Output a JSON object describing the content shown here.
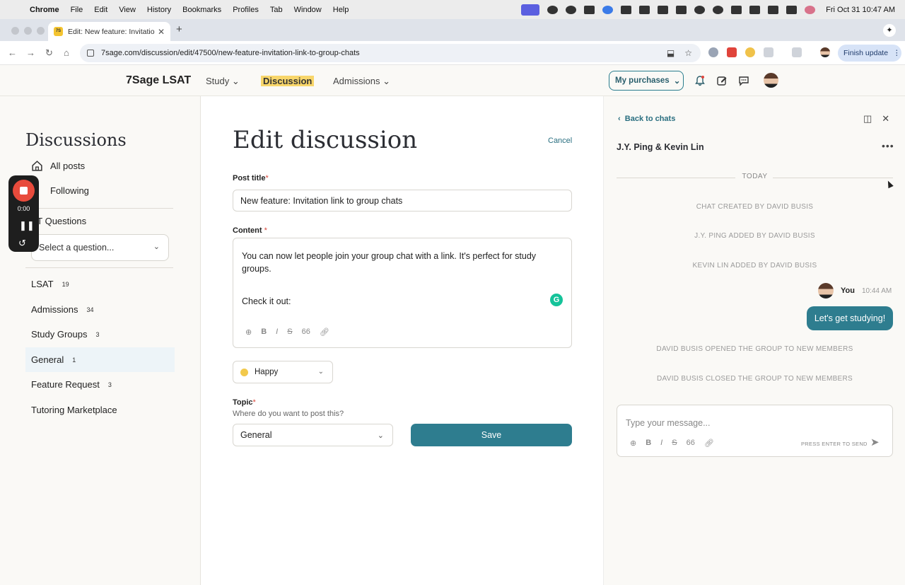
{
  "menubar": {
    "items": [
      "Chrome",
      "File",
      "Edit",
      "View",
      "History",
      "Bookmarks",
      "Profiles",
      "Tab",
      "Window",
      "Help"
    ],
    "clock": "Fri Oct 31  10:47 AM"
  },
  "browser": {
    "tab_title": "Edit: New feature: Invitation li",
    "favicon_text": "7S",
    "url": "7sage.com/discussion/edit/47500/new-feature-invitation-link-to-group-chats",
    "finish_update": "Finish update"
  },
  "site": {
    "logo": "7Sage LSAT",
    "nav": {
      "study": "Study",
      "discussion": "Discussion",
      "admissions": "Admissions"
    },
    "purchases_label": "My purchases"
  },
  "sidebar": {
    "title": "Discussions",
    "all_posts": "All posts",
    "following": "Following",
    "questions_header": "LT Questions",
    "question_select_placeholder": "Select a question...",
    "categories": [
      {
        "label": "LSAT",
        "count": "19"
      },
      {
        "label": "Admissions",
        "count": "34"
      },
      {
        "label": "Study Groups",
        "count": "3"
      },
      {
        "label": "General",
        "count": "1"
      },
      {
        "label": "Feature Request",
        "count": "3"
      },
      {
        "label": "Tutoring Marketplace",
        "count": ""
      }
    ]
  },
  "recorder": {
    "time": "0:00"
  },
  "editor": {
    "heading": "Edit discussion",
    "cancel": "Cancel",
    "post_title_label": "Post title",
    "post_title_value": "New feature: Invitation link to group chats",
    "content_label": "Content",
    "content_p1": "You can now let people join your group chat with a link. It's perfect for study groups.",
    "content_p2": "Check it out:",
    "mood_value": "Happy",
    "topic_label": "Topic",
    "topic_hint": "Where do you want to post this?",
    "topic_value": "General",
    "save_label": "Save",
    "required_mark": "*"
  },
  "chat": {
    "back": "Back to chats",
    "name": "J.Y. Ping & Kevin Lin",
    "more": "•••",
    "date_divider": "TODAY",
    "events": [
      "CHAT CREATED BY DAVID BUSIS",
      "J.Y. PING ADDED BY DAVID BUSIS",
      "KEVIN LIN ADDED BY DAVID BUSIS"
    ],
    "message": {
      "sender": "You",
      "time": "10:44 AM",
      "text": "Let's get studying!"
    },
    "events_after": [
      "DAVID BUSIS OPENED THE GROUP TO NEW MEMBERS",
      "DAVID BUSIS CLOSED THE GROUP TO NEW MEMBERS"
    ],
    "composer_placeholder": "Type your message...",
    "send_hint": "PRESS ENTER TO SEND"
  }
}
